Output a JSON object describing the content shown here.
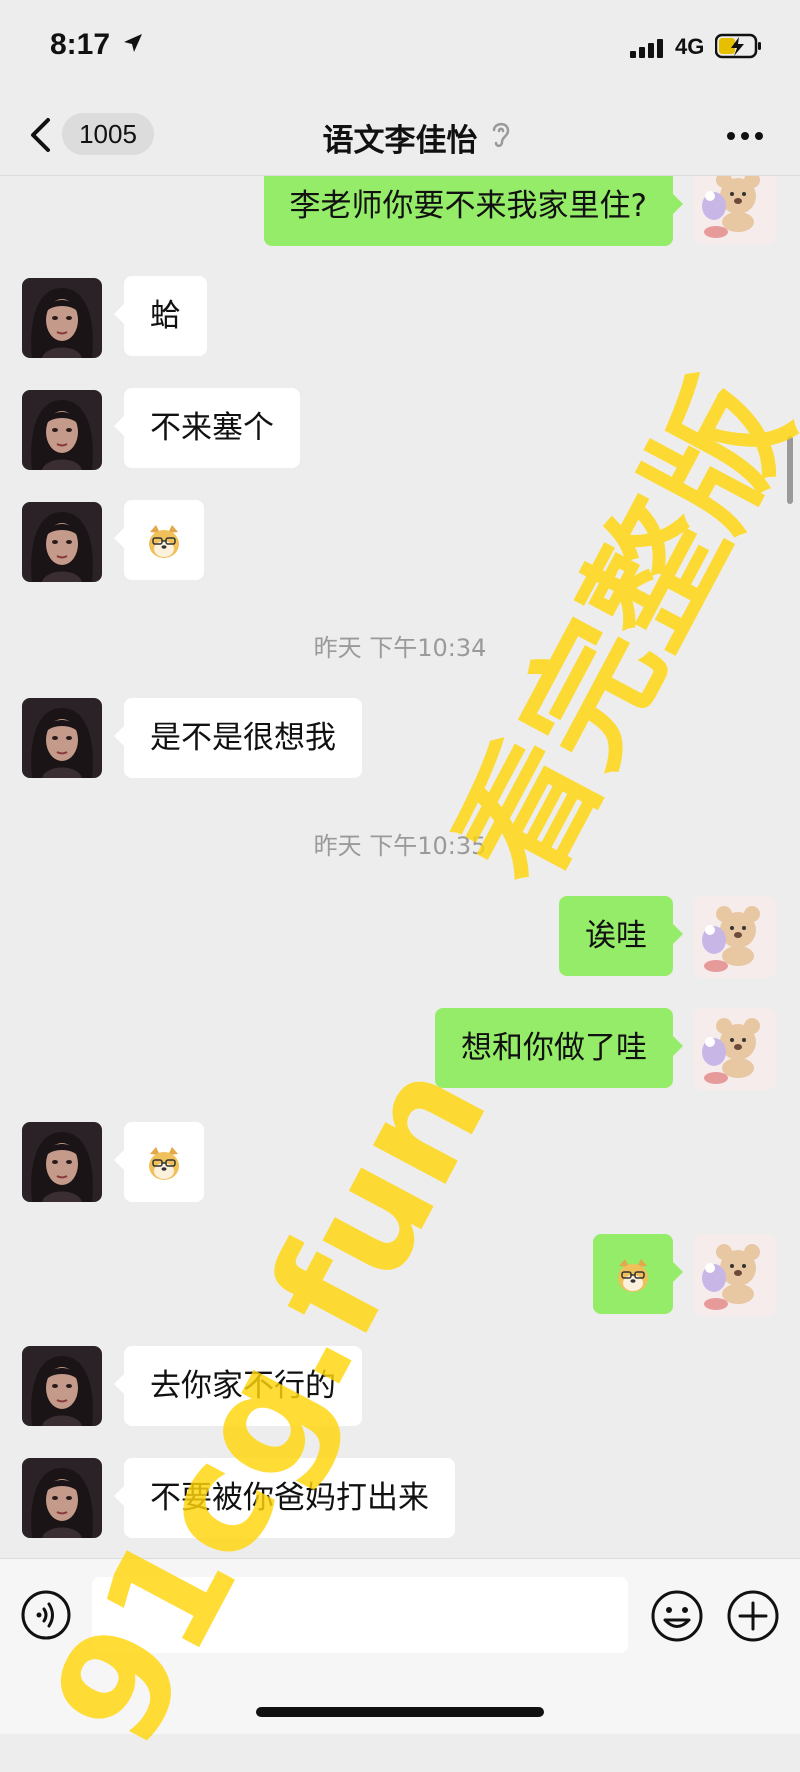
{
  "status_bar": {
    "time": "8:17",
    "network": "4G"
  },
  "nav": {
    "unread_count": "1005",
    "title": "语文李佳怡"
  },
  "messages": [
    {
      "side": "right",
      "type": "text",
      "text": "李老师你要不来我家里住?"
    },
    {
      "side": "left",
      "type": "text",
      "text": "蛤"
    },
    {
      "side": "left",
      "type": "text",
      "text": "不来塞个"
    },
    {
      "side": "left",
      "type": "sticker",
      "sticker": "doge-sticker"
    },
    {
      "type": "time",
      "text": "昨天 下午10:34"
    },
    {
      "side": "left",
      "type": "text",
      "text": "是不是很想我"
    },
    {
      "type": "time",
      "text": "昨天 下午10:35"
    },
    {
      "side": "right",
      "type": "text",
      "text": "诶哇"
    },
    {
      "side": "right",
      "type": "text",
      "text": "想和你做了哇"
    },
    {
      "side": "left",
      "type": "sticker",
      "sticker": "doge-sticker"
    },
    {
      "side": "right",
      "type": "sticker",
      "sticker": "doge-sticker"
    },
    {
      "side": "left",
      "type": "text",
      "text": "去你家不行的"
    },
    {
      "side": "left",
      "type": "text",
      "text": "不要被你爸妈打出来"
    }
  ],
  "watermark": {
    "text_1": "91cg.fun",
    "text_2": "看完整版"
  },
  "icons": {
    "left_avatar": "woman-portrait-avatar",
    "right_avatar": "bear-sticker-avatar",
    "voice": "voice-icon",
    "emoji": "emoji-icon",
    "plus": "plus-icon"
  },
  "colors": {
    "background": "#ededed",
    "sent_bubble": "#95ec69",
    "received_bubble": "#ffffff",
    "watermark": "#ffd60a"
  }
}
